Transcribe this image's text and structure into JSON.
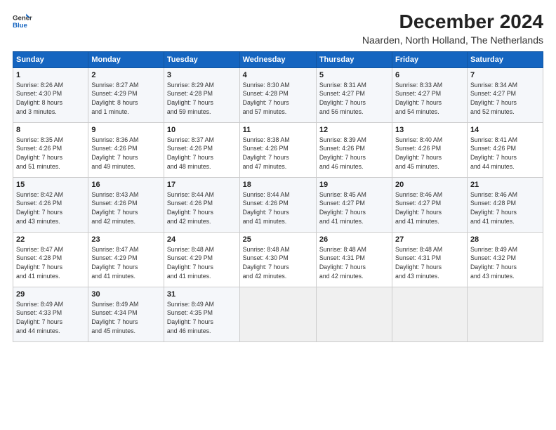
{
  "header": {
    "title": "December 2024",
    "subtitle": "Naarden, North Holland, The Netherlands"
  },
  "columns": [
    "Sunday",
    "Monday",
    "Tuesday",
    "Wednesday",
    "Thursday",
    "Friday",
    "Saturday"
  ],
  "weeks": [
    [
      {
        "day": "1",
        "info": "Sunrise: 8:26 AM\nSunset: 4:30 PM\nDaylight: 8 hours\nand 3 minutes."
      },
      {
        "day": "2",
        "info": "Sunrise: 8:27 AM\nSunset: 4:29 PM\nDaylight: 8 hours\nand 1 minute."
      },
      {
        "day": "3",
        "info": "Sunrise: 8:29 AM\nSunset: 4:28 PM\nDaylight: 7 hours\nand 59 minutes."
      },
      {
        "day": "4",
        "info": "Sunrise: 8:30 AM\nSunset: 4:28 PM\nDaylight: 7 hours\nand 57 minutes."
      },
      {
        "day": "5",
        "info": "Sunrise: 8:31 AM\nSunset: 4:27 PM\nDaylight: 7 hours\nand 56 minutes."
      },
      {
        "day": "6",
        "info": "Sunrise: 8:33 AM\nSunset: 4:27 PM\nDaylight: 7 hours\nand 54 minutes."
      },
      {
        "day": "7",
        "info": "Sunrise: 8:34 AM\nSunset: 4:27 PM\nDaylight: 7 hours\nand 52 minutes."
      }
    ],
    [
      {
        "day": "8",
        "info": "Sunrise: 8:35 AM\nSunset: 4:26 PM\nDaylight: 7 hours\nand 51 minutes."
      },
      {
        "day": "9",
        "info": "Sunrise: 8:36 AM\nSunset: 4:26 PM\nDaylight: 7 hours\nand 49 minutes."
      },
      {
        "day": "10",
        "info": "Sunrise: 8:37 AM\nSunset: 4:26 PM\nDaylight: 7 hours\nand 48 minutes."
      },
      {
        "day": "11",
        "info": "Sunrise: 8:38 AM\nSunset: 4:26 PM\nDaylight: 7 hours\nand 47 minutes."
      },
      {
        "day": "12",
        "info": "Sunrise: 8:39 AM\nSunset: 4:26 PM\nDaylight: 7 hours\nand 46 minutes."
      },
      {
        "day": "13",
        "info": "Sunrise: 8:40 AM\nSunset: 4:26 PM\nDaylight: 7 hours\nand 45 minutes."
      },
      {
        "day": "14",
        "info": "Sunrise: 8:41 AM\nSunset: 4:26 PM\nDaylight: 7 hours\nand 44 minutes."
      }
    ],
    [
      {
        "day": "15",
        "info": "Sunrise: 8:42 AM\nSunset: 4:26 PM\nDaylight: 7 hours\nand 43 minutes."
      },
      {
        "day": "16",
        "info": "Sunrise: 8:43 AM\nSunset: 4:26 PM\nDaylight: 7 hours\nand 42 minutes."
      },
      {
        "day": "17",
        "info": "Sunrise: 8:44 AM\nSunset: 4:26 PM\nDaylight: 7 hours\nand 42 minutes."
      },
      {
        "day": "18",
        "info": "Sunrise: 8:44 AM\nSunset: 4:26 PM\nDaylight: 7 hours\nand 41 minutes."
      },
      {
        "day": "19",
        "info": "Sunrise: 8:45 AM\nSunset: 4:27 PM\nDaylight: 7 hours\nand 41 minutes."
      },
      {
        "day": "20",
        "info": "Sunrise: 8:46 AM\nSunset: 4:27 PM\nDaylight: 7 hours\nand 41 minutes."
      },
      {
        "day": "21",
        "info": "Sunrise: 8:46 AM\nSunset: 4:28 PM\nDaylight: 7 hours\nand 41 minutes."
      }
    ],
    [
      {
        "day": "22",
        "info": "Sunrise: 8:47 AM\nSunset: 4:28 PM\nDaylight: 7 hours\nand 41 minutes."
      },
      {
        "day": "23",
        "info": "Sunrise: 8:47 AM\nSunset: 4:29 PM\nDaylight: 7 hours\nand 41 minutes."
      },
      {
        "day": "24",
        "info": "Sunrise: 8:48 AM\nSunset: 4:29 PM\nDaylight: 7 hours\nand 41 minutes."
      },
      {
        "day": "25",
        "info": "Sunrise: 8:48 AM\nSunset: 4:30 PM\nDaylight: 7 hours\nand 42 minutes."
      },
      {
        "day": "26",
        "info": "Sunrise: 8:48 AM\nSunset: 4:31 PM\nDaylight: 7 hours\nand 42 minutes."
      },
      {
        "day": "27",
        "info": "Sunrise: 8:48 AM\nSunset: 4:31 PM\nDaylight: 7 hours\nand 43 minutes."
      },
      {
        "day": "28",
        "info": "Sunrise: 8:49 AM\nSunset: 4:32 PM\nDaylight: 7 hours\nand 43 minutes."
      }
    ],
    [
      {
        "day": "29",
        "info": "Sunrise: 8:49 AM\nSunset: 4:33 PM\nDaylight: 7 hours\nand 44 minutes."
      },
      {
        "day": "30",
        "info": "Sunrise: 8:49 AM\nSunset: 4:34 PM\nDaylight: 7 hours\nand 45 minutes."
      },
      {
        "day": "31",
        "info": "Sunrise: 8:49 AM\nSunset: 4:35 PM\nDaylight: 7 hours\nand 46 minutes."
      },
      {
        "day": "",
        "info": ""
      },
      {
        "day": "",
        "info": ""
      },
      {
        "day": "",
        "info": ""
      },
      {
        "day": "",
        "info": ""
      }
    ]
  ]
}
